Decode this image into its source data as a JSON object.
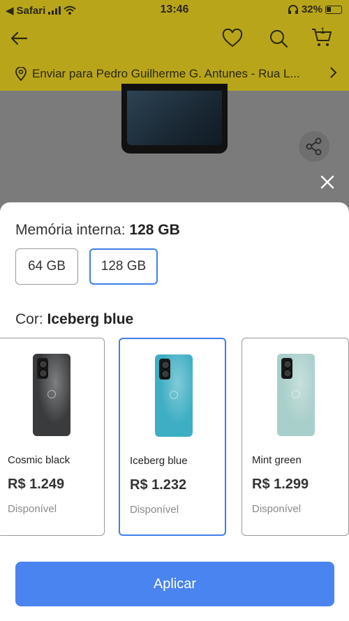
{
  "status_bar": {
    "back_app": "Safari",
    "time": "13:46",
    "battery": "32%"
  },
  "header": {
    "address": "Enviar para Pedro Guilherme G. Antunes - Rua L...",
    "cart_count": "1"
  },
  "memory": {
    "label": "Memória interna: ",
    "selected": "128 GB",
    "options": [
      {
        "label": "64 GB",
        "selected": false
      },
      {
        "label": "128 GB",
        "selected": true
      }
    ]
  },
  "color": {
    "label": "Cor: ",
    "selected": "Iceberg blue",
    "options": [
      {
        "name": "Cosmic black",
        "price": "R$ 1.249",
        "availability": "Disponível",
        "swatch": "#3a3b3d",
        "selected": false
      },
      {
        "name": "Iceberg blue",
        "price": "R$ 1.232",
        "availability": "Disponível",
        "swatch": "#3eaec4",
        "selected": true
      },
      {
        "name": "Mint green",
        "price": "R$ 1.299",
        "availability": "Disponível",
        "swatch": "#a9cfca",
        "selected": false
      }
    ]
  },
  "apply_button": "Aplicar",
  "colors": {
    "accent": "#3f7ee8",
    "button": "#4a84f0",
    "header_bg": "#b8a51a"
  }
}
